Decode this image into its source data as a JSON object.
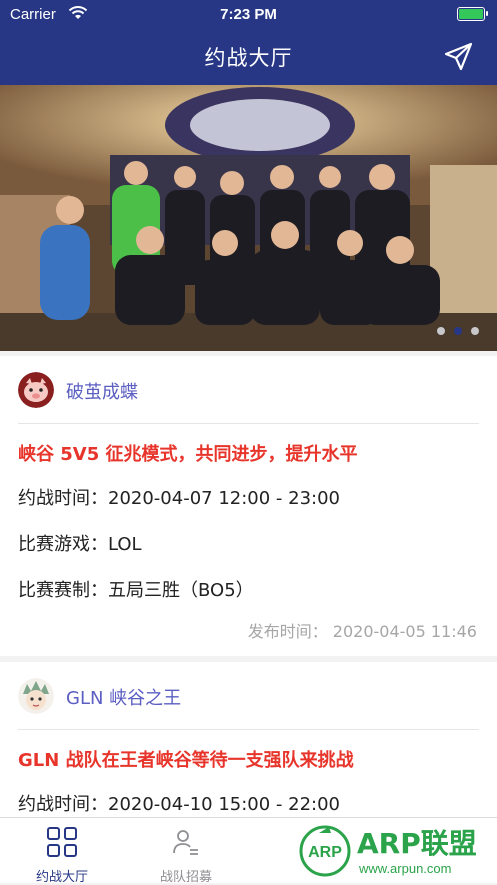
{
  "status_bar": {
    "carrier": "Carrier",
    "time": "7:23 PM"
  },
  "nav": {
    "title": "约战大厅",
    "action_icon": "send-icon"
  },
  "banner": {
    "total_slides": 3,
    "active_slide": 2
  },
  "posts": [
    {
      "team": "破茧成蝶",
      "title": "峡谷 5V5 征兆模式，共同进步，提升水平",
      "time_label": "约战时间：",
      "time_value": "2020-04-07 12:00 - 23:00",
      "game_label": "比赛游戏：",
      "game_value": "LOL",
      "format_label": "比赛赛制：",
      "format_value": "五局三胜（BO5）",
      "publish": "发布时间：  2020-04-05 11:46"
    },
    {
      "team": "GLN 峡谷之王",
      "title": "GLN 战队在王者峡谷等待一支强队来挑战",
      "time_label": "约战时间：",
      "time_value": "2020-04-10 15:00 - 22:00"
    }
  ],
  "tabbar": {
    "tabs": [
      {
        "label": "约战大厅",
        "icon": "grid-icon",
        "active": true
      },
      {
        "label": "战队招募",
        "icon": "person-list-icon",
        "active": false
      }
    ]
  },
  "watermark": {
    "brand": "ARP联盟",
    "site": "www.arpun.com",
    "badge": "ARP"
  },
  "colors": {
    "primary": "#273785",
    "accent_red": "#e8352b",
    "team_name": "#5b5ec2"
  }
}
